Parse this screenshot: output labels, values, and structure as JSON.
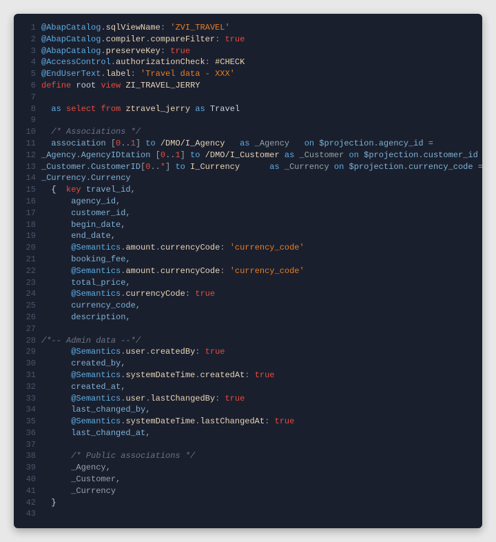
{
  "lines": [
    {
      "n": "1",
      "parts": [
        {
          "c": "at",
          "t": "@AbapCatalog"
        },
        {
          "c": "dot",
          "t": "."
        },
        {
          "c": "prop",
          "t": "sqlViewName"
        },
        {
          "c": "punct",
          "t": ": "
        },
        {
          "c": "str",
          "t": "'ZVI_TRAVEL'"
        }
      ]
    },
    {
      "n": "2",
      "parts": [
        {
          "c": "at",
          "t": "@AbapCatalog"
        },
        {
          "c": "dot",
          "t": "."
        },
        {
          "c": "prop",
          "t": "compiler"
        },
        {
          "c": "dot",
          "t": "."
        },
        {
          "c": "prop",
          "t": "compareFilter"
        },
        {
          "c": "punct",
          "t": ": "
        },
        {
          "c": "kw-true",
          "t": "true"
        }
      ]
    },
    {
      "n": "3",
      "parts": [
        {
          "c": "at",
          "t": "@AbapCatalog"
        },
        {
          "c": "dot",
          "t": "."
        },
        {
          "c": "prop",
          "t": "preserveKey"
        },
        {
          "c": "punct",
          "t": ": "
        },
        {
          "c": "kw-true",
          "t": "true"
        }
      ]
    },
    {
      "n": "4",
      "parts": [
        {
          "c": "at",
          "t": "@AccessControl"
        },
        {
          "c": "dot",
          "t": "."
        },
        {
          "c": "prop",
          "t": "authorizationCheck"
        },
        {
          "c": "punct",
          "t": ": "
        },
        {
          "c": "prop",
          "t": "#CHECK"
        }
      ]
    },
    {
      "n": "5",
      "parts": [
        {
          "c": "at",
          "t": "@EndUserText"
        },
        {
          "c": "dot",
          "t": "."
        },
        {
          "c": "prop",
          "t": "label"
        },
        {
          "c": "punct",
          "t": ": "
        },
        {
          "c": "str",
          "t": "'Travel data - XXX'"
        }
      ]
    },
    {
      "n": "6",
      "parts": [
        {
          "c": "kw-true",
          "t": "define"
        },
        {
          "c": "ident",
          "t": " root "
        },
        {
          "c": "kw-true",
          "t": "view"
        },
        {
          "c": "entity",
          "t": " ZI_TRAVEL_JERRY"
        }
      ]
    },
    {
      "n": "7",
      "parts": []
    },
    {
      "n": "8",
      "parts": [
        {
          "c": "ident",
          "t": "  "
        },
        {
          "c": "kw",
          "t": "as"
        },
        {
          "c": "ident",
          "t": " "
        },
        {
          "c": "kw-true",
          "t": "select"
        },
        {
          "c": "ident",
          "t": " "
        },
        {
          "c": "kw-true",
          "t": "from"
        },
        {
          "c": "entity",
          "t": " ztravel_jerry "
        },
        {
          "c": "kw",
          "t": "as"
        },
        {
          "c": "ident",
          "t": " Travel"
        }
      ]
    },
    {
      "n": "9",
      "parts": []
    },
    {
      "n": "10",
      "parts": [
        {
          "c": "cmt",
          "t": "  /* Associations */"
        }
      ]
    },
    {
      "n": "11",
      "parts": [
        {
          "c": "field",
          "t": "  association "
        },
        {
          "c": "punct",
          "t": "["
        },
        {
          "c": "num",
          "t": "0"
        },
        {
          "c": "punct",
          "t": ".."
        },
        {
          "c": "num",
          "t": "1"
        },
        {
          "c": "punct",
          "t": "] "
        },
        {
          "c": "kw",
          "t": "to"
        },
        {
          "c": "entity",
          "t": " /DMO/I_Agency   "
        },
        {
          "c": "kw",
          "t": "as"
        },
        {
          "c": "alias",
          "t": " _Agency   "
        },
        {
          "c": "kw",
          "t": "on"
        },
        {
          "c": "field",
          "t": " $projection"
        },
        {
          "c": "punct",
          "t": "."
        },
        {
          "c": "field",
          "t": "agency_id "
        },
        {
          "c": "punct",
          "t": "="
        }
      ]
    },
    {
      "n": "12",
      "parts": [
        {
          "c": "field",
          "t": "_Agency"
        },
        {
          "c": "punct",
          "t": "."
        },
        {
          "c": "field",
          "t": "AgencyID"
        },
        {
          "c": "field",
          "t": "tation "
        },
        {
          "c": "punct",
          "t": "["
        },
        {
          "c": "num",
          "t": "0"
        },
        {
          "c": "punct",
          "t": ".."
        },
        {
          "c": "num",
          "t": "1"
        },
        {
          "c": "punct",
          "t": "] "
        },
        {
          "c": "kw",
          "t": "to"
        },
        {
          "c": "entity",
          "t": " /DMO/I_Customer "
        },
        {
          "c": "kw",
          "t": "as"
        },
        {
          "c": "alias",
          "t": " _Customer "
        },
        {
          "c": "kw",
          "t": "on"
        },
        {
          "c": "field",
          "t": " $projection"
        },
        {
          "c": "punct",
          "t": "."
        },
        {
          "c": "field",
          "t": "customer_id "
        },
        {
          "c": "punct",
          "t": "="
        }
      ]
    },
    {
      "n": "13",
      "parts": [
        {
          "c": "field",
          "t": "_Customer"
        },
        {
          "c": "punct",
          "t": "."
        },
        {
          "c": "field",
          "t": "CustomerID"
        },
        {
          "c": "punct",
          "t": "["
        },
        {
          "c": "num",
          "t": "0"
        },
        {
          "c": "punct",
          "t": ".."
        },
        {
          "c": "kw-true",
          "t": "*"
        },
        {
          "c": "punct",
          "t": "] "
        },
        {
          "c": "kw",
          "t": "to"
        },
        {
          "c": "entity",
          "t": " I_Currency      "
        },
        {
          "c": "kw",
          "t": "as"
        },
        {
          "c": "alias",
          "t": " _Currency "
        },
        {
          "c": "kw",
          "t": "on"
        },
        {
          "c": "field",
          "t": " $projection"
        },
        {
          "c": "punct",
          "t": "."
        },
        {
          "c": "field",
          "t": "currency_code "
        },
        {
          "c": "punct",
          "t": "="
        }
      ]
    },
    {
      "n": "14",
      "parts": [
        {
          "c": "field",
          "t": "_Currency"
        },
        {
          "c": "punct",
          "t": "."
        },
        {
          "c": "field",
          "t": "Currency"
        }
      ]
    },
    {
      "n": "15",
      "parts": [
        {
          "c": "ident",
          "t": "  {  "
        },
        {
          "c": "kw-true",
          "t": "key"
        },
        {
          "c": "field",
          "t": " travel_id"
        },
        {
          "c": "punct",
          "t": ","
        }
      ]
    },
    {
      "n": "16",
      "parts": [
        {
          "c": "field",
          "t": "      agency_id"
        },
        {
          "c": "punct",
          "t": ","
        }
      ]
    },
    {
      "n": "17",
      "parts": [
        {
          "c": "field",
          "t": "      customer_id"
        },
        {
          "c": "punct",
          "t": ","
        }
      ]
    },
    {
      "n": "18",
      "parts": [
        {
          "c": "field",
          "t": "      begin_date"
        },
        {
          "c": "punct",
          "t": ","
        }
      ]
    },
    {
      "n": "19",
      "parts": [
        {
          "c": "field",
          "t": "      end_date"
        },
        {
          "c": "punct",
          "t": ","
        }
      ]
    },
    {
      "n": "20",
      "parts": [
        {
          "c": "ident",
          "t": "      "
        },
        {
          "c": "at",
          "t": "@Semantics"
        },
        {
          "c": "dot",
          "t": "."
        },
        {
          "c": "prop",
          "t": "amount"
        },
        {
          "c": "dot",
          "t": "."
        },
        {
          "c": "prop",
          "t": "currencyCode"
        },
        {
          "c": "punct",
          "t": ": "
        },
        {
          "c": "str",
          "t": "'currency_code'"
        }
      ]
    },
    {
      "n": "21",
      "parts": [
        {
          "c": "field",
          "t": "      booking_fee"
        },
        {
          "c": "punct",
          "t": ","
        }
      ]
    },
    {
      "n": "22",
      "parts": [
        {
          "c": "ident",
          "t": "      "
        },
        {
          "c": "at",
          "t": "@Semantics"
        },
        {
          "c": "dot",
          "t": "."
        },
        {
          "c": "prop",
          "t": "amount"
        },
        {
          "c": "dot",
          "t": "."
        },
        {
          "c": "prop",
          "t": "currencyCode"
        },
        {
          "c": "punct",
          "t": ": "
        },
        {
          "c": "str",
          "t": "'currency_code'"
        }
      ]
    },
    {
      "n": "23",
      "parts": [
        {
          "c": "field",
          "t": "      total_price"
        },
        {
          "c": "punct",
          "t": ","
        }
      ]
    },
    {
      "n": "24",
      "parts": [
        {
          "c": "ident",
          "t": "      "
        },
        {
          "c": "at",
          "t": "@Semantics"
        },
        {
          "c": "dot",
          "t": "."
        },
        {
          "c": "prop",
          "t": "currencyCode"
        },
        {
          "c": "punct",
          "t": ": "
        },
        {
          "c": "kw-true",
          "t": "true"
        }
      ]
    },
    {
      "n": "25",
      "parts": [
        {
          "c": "field",
          "t": "      currency_code"
        },
        {
          "c": "punct",
          "t": ","
        }
      ]
    },
    {
      "n": "26",
      "parts": [
        {
          "c": "field",
          "t": "      description"
        },
        {
          "c": "punct",
          "t": ","
        }
      ]
    },
    {
      "n": "27",
      "parts": []
    },
    {
      "n": "28",
      "parts": [
        {
          "c": "cmt",
          "t": "/*-- Admin data --*/"
        }
      ]
    },
    {
      "n": "29",
      "parts": [
        {
          "c": "ident",
          "t": "      "
        },
        {
          "c": "at",
          "t": "@Semantics"
        },
        {
          "c": "dot",
          "t": "."
        },
        {
          "c": "prop",
          "t": "user"
        },
        {
          "c": "dot",
          "t": "."
        },
        {
          "c": "prop",
          "t": "createdBy"
        },
        {
          "c": "punct",
          "t": ": "
        },
        {
          "c": "kw-true",
          "t": "true"
        }
      ]
    },
    {
      "n": "30",
      "parts": [
        {
          "c": "field",
          "t": "      created_by"
        },
        {
          "c": "punct",
          "t": ","
        }
      ]
    },
    {
      "n": "31",
      "parts": [
        {
          "c": "ident",
          "t": "      "
        },
        {
          "c": "at",
          "t": "@Semantics"
        },
        {
          "c": "dot",
          "t": "."
        },
        {
          "c": "prop",
          "t": "systemDateTime"
        },
        {
          "c": "dot",
          "t": "."
        },
        {
          "c": "prop",
          "t": "createdAt"
        },
        {
          "c": "punct",
          "t": ": "
        },
        {
          "c": "kw-true",
          "t": "true"
        }
      ]
    },
    {
      "n": "32",
      "parts": [
        {
          "c": "field",
          "t": "      created_at"
        },
        {
          "c": "punct",
          "t": ","
        }
      ]
    },
    {
      "n": "33",
      "parts": [
        {
          "c": "ident",
          "t": "      "
        },
        {
          "c": "at",
          "t": "@Semantics"
        },
        {
          "c": "dot",
          "t": "."
        },
        {
          "c": "prop",
          "t": "user"
        },
        {
          "c": "dot",
          "t": "."
        },
        {
          "c": "prop",
          "t": "lastChangedBy"
        },
        {
          "c": "punct",
          "t": ": "
        },
        {
          "c": "kw-true",
          "t": "true"
        }
      ]
    },
    {
      "n": "34",
      "parts": [
        {
          "c": "field",
          "t": "      last_changed_by"
        },
        {
          "c": "punct",
          "t": ","
        }
      ]
    },
    {
      "n": "35",
      "parts": [
        {
          "c": "ident",
          "t": "      "
        },
        {
          "c": "at",
          "t": "@Semantics"
        },
        {
          "c": "dot",
          "t": "."
        },
        {
          "c": "prop",
          "t": "systemDateTime"
        },
        {
          "c": "dot",
          "t": "."
        },
        {
          "c": "prop",
          "t": "lastChangedAt"
        },
        {
          "c": "punct",
          "t": ": "
        },
        {
          "c": "kw-true",
          "t": "true"
        }
      ]
    },
    {
      "n": "36",
      "parts": [
        {
          "c": "field",
          "t": "      last_changed_at"
        },
        {
          "c": "punct",
          "t": ","
        }
      ]
    },
    {
      "n": "37",
      "parts": []
    },
    {
      "n": "38",
      "parts": [
        {
          "c": "cmt",
          "t": "      /* Public associations */"
        }
      ]
    },
    {
      "n": "39",
      "parts": [
        {
          "c": "alias",
          "t": "      _Agency"
        },
        {
          "c": "punct",
          "t": ","
        }
      ]
    },
    {
      "n": "40",
      "parts": [
        {
          "c": "alias",
          "t": "      _Customer"
        },
        {
          "c": "punct",
          "t": ","
        }
      ]
    },
    {
      "n": "41",
      "parts": [
        {
          "c": "alias",
          "t": "      _Currency"
        }
      ]
    },
    {
      "n": "42",
      "parts": [
        {
          "c": "ident",
          "t": "  }"
        }
      ]
    },
    {
      "n": "43",
      "parts": []
    }
  ]
}
